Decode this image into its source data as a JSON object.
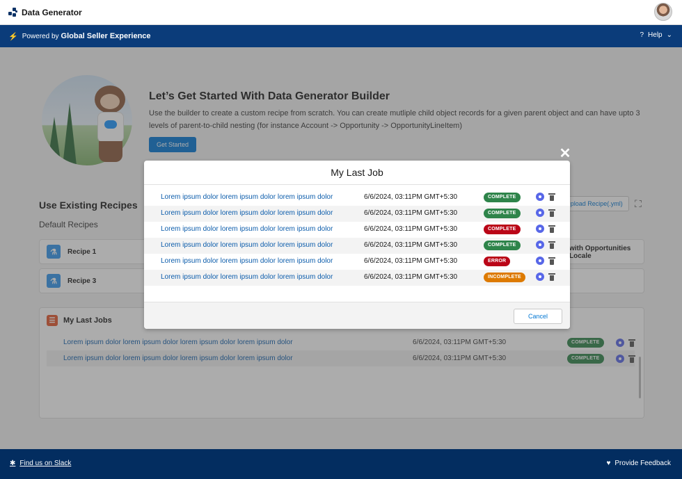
{
  "app": {
    "title": "Data Generator"
  },
  "bluebar": {
    "powered_by": "Powered by",
    "brand": "Global Seller Experience",
    "help": "Help"
  },
  "hero": {
    "title": "Let’s Get Started With Data Generator Builder",
    "description": "Use the builder to create a custom recipe from scratch. You can create mutliple child object records for a given parent object and can have upto 3 levels of parent-to-child nesting (for instance Account -> Opportunity -> OpportunityLineItem)",
    "button": "Get Started"
  },
  "recipes": {
    "title": "Use Existing Recipes",
    "subtitle": "Default Recipes",
    "upload_button": "Upload Recipe(.yml)",
    "items": [
      {
        "label": "Recipe 1"
      },
      {
        "label": "Recipe 3"
      }
    ],
    "right_partial_1": "with Opportunities",
    "right_partial_2": "Locale"
  },
  "last_jobs": {
    "title": "My Last Jobs",
    "rows": [
      {
        "name": "Lorem ipsum dolor lorem ipsum dolor lorem ipsum dolor lorem ipsum dolor",
        "date": "6/6/2024, 03:11PM GMT+5:30",
        "status": "COMPLETE"
      },
      {
        "name": "Lorem ipsum dolor lorem ipsum dolor lorem ipsum dolor lorem ipsum dolor",
        "date": "6/6/2024, 03:11PM GMT+5:30",
        "status": "COMPLETE"
      }
    ]
  },
  "modal": {
    "title": "My Last Job",
    "cancel": "Cancel",
    "rows": [
      {
        "name": "Lorem ipsum dolor lorem ipsum dolor lorem ipsum dolor",
        "date": "6/6/2024, 03:11PM GMT+5:30",
        "status": "COMPLETE"
      },
      {
        "name": "Lorem ipsum dolor lorem ipsum dolor lorem ipsum dolor",
        "date": "6/6/2024, 03:11PM GMT+5:30",
        "status": "COMPLETE"
      },
      {
        "name": "Lorem ipsum dolor lorem ipsum dolor lorem ipsum dolor",
        "date": "6/6/2024, 03:11PM GMT+5:30",
        "status": "COMPLETE"
      },
      {
        "name": "Lorem ipsum dolor lorem ipsum dolor lorem ipsum dolor",
        "date": "6/6/2024, 03:11PM GMT+5:30",
        "status": "COMPLETE"
      },
      {
        "name": "Lorem ipsum dolor lorem ipsum dolor lorem ipsum dolor",
        "date": "6/6/2024, 03:11PM GMT+5:30",
        "status": "ERROR"
      },
      {
        "name": "Lorem ipsum dolor lorem ipsum dolor lorem ipsum dolor",
        "date": "6/6/2024, 03:11PM GMT+5:30",
        "status": "INCOMPLETE"
      }
    ]
  },
  "footer": {
    "slack": "Find us on Slack",
    "feedback": "Provide Feedback"
  },
  "colors": {
    "brand_blue": "#0b3c7a",
    "footer_navy": "#032d60",
    "link": "#0b5cab",
    "complete": "#2e844a",
    "error": "#ba0517",
    "incomplete": "#dd7a01"
  },
  "icons": [
    "bolt-icon",
    "help-icon",
    "chevron-down-icon",
    "close-icon",
    "eye-icon",
    "trash-icon",
    "expand-icon",
    "flask-icon",
    "list-icon",
    "slack-icon",
    "heart-icon"
  ]
}
